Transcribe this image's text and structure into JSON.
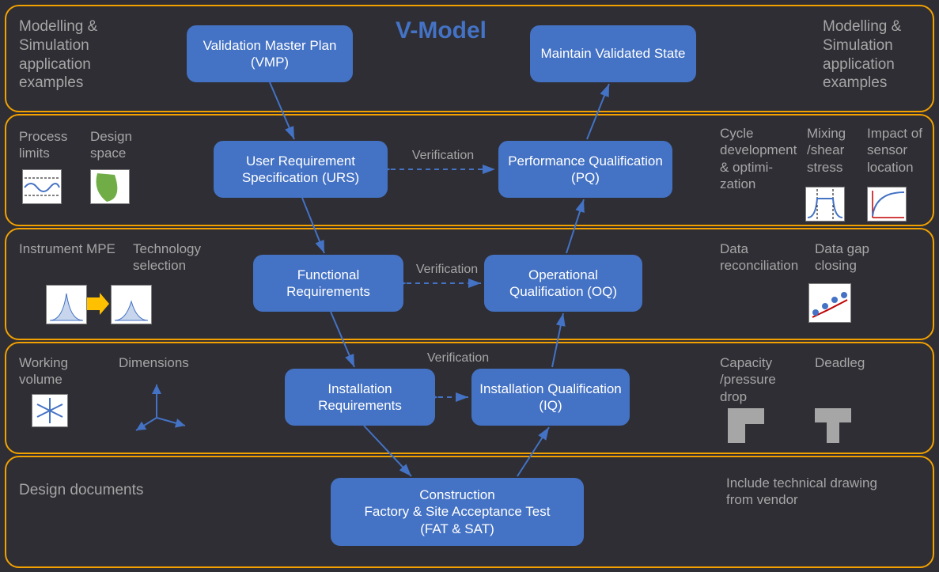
{
  "title": "V-Model",
  "rows": {
    "r1_left": "Modelling & Simulation application examples",
    "r1_right": "Modelling & Simulation application examples",
    "r2_l1": "Process limits",
    "r2_l2": "Design space",
    "r2_r1": "Cycle develop­ment & optimi­zation",
    "r2_r2": "Mixing /shear stress",
    "r2_r3": "Impact of sensor location",
    "r3_l1": "Instrument MPE",
    "r3_l2": "Technology selection",
    "r3_r1": "Data reconciliation",
    "r3_r2": "Data gap closing",
    "r4_l1": "Working volume",
    "r4_l2": "Dimensions",
    "r4_r1": "Capacity /pressure drop",
    "r4_r2": "Deadleg",
    "r5_left": "Design documents",
    "r5_right": "Include technical drawing from vendor"
  },
  "nodes": {
    "vmp": "Validation Master Plan (VMP)",
    "maintain": "Maintain Validated State",
    "urs": "User Requirement Specification (URS)",
    "pq": "Performance Qualification (PQ)",
    "fr": "Functional Requirements",
    "oq": "Operational Qualification (OQ)",
    "ir": "Installation Requirements",
    "iq": "Installation Qualification (IQ)",
    "fat": "Construction\nFactory & Site Acceptance Test\n(FAT & SAT)"
  },
  "verification": "Verification"
}
